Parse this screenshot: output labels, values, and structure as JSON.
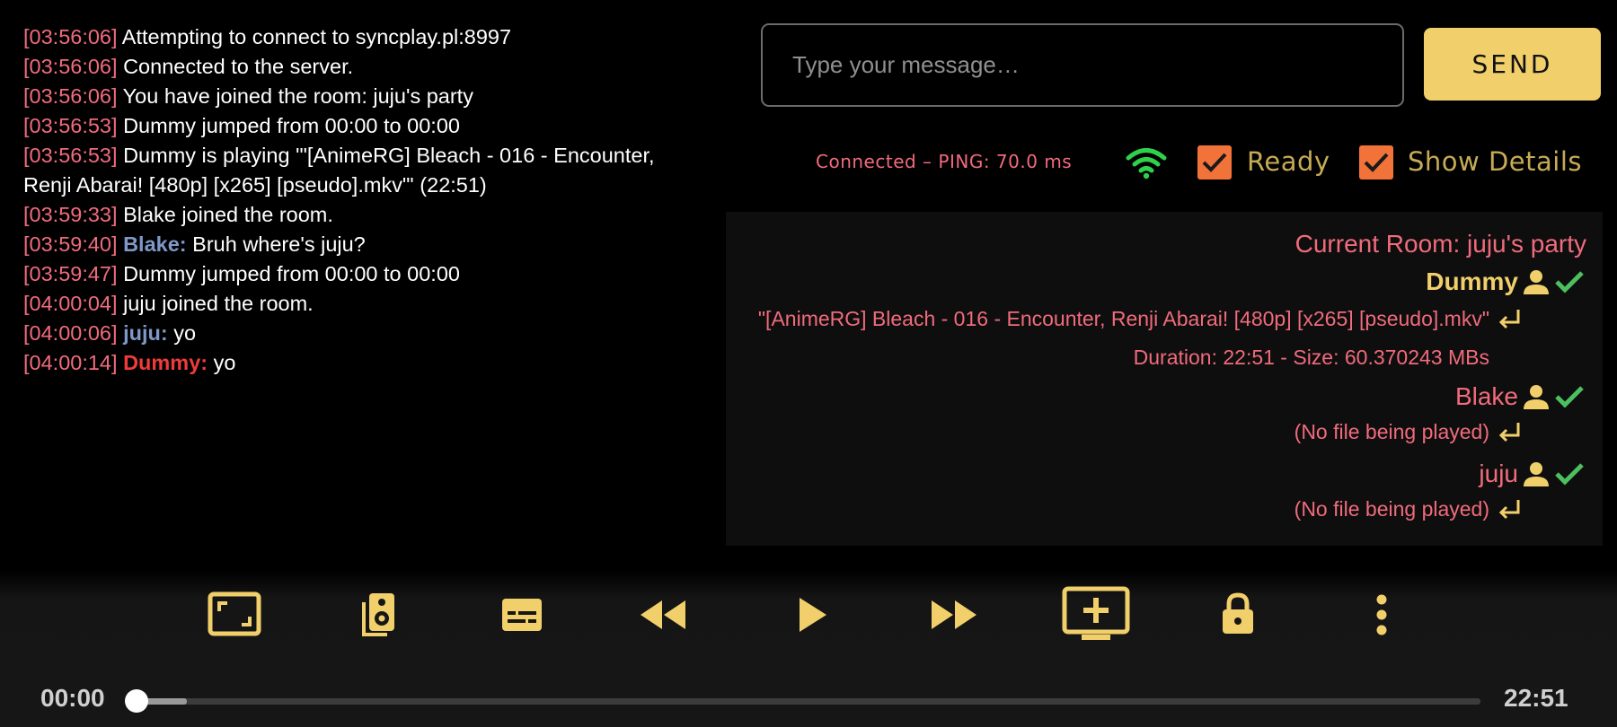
{
  "chat": {
    "messages": [
      {
        "time": "[03:56:06]",
        "user": "",
        "text": "Attempting to connect to syncplay.pl:8997"
      },
      {
        "time": "[03:56:06]",
        "user": "",
        "text": "Connected to the server."
      },
      {
        "time": "[03:56:06]",
        "user": "",
        "text": "You have joined the room: juju's party"
      },
      {
        "time": "[03:56:53]",
        "user": "",
        "text": "Dummy jumped from 00:00 to 00:00"
      },
      {
        "time": "[03:56:53]",
        "user": "",
        "text": "Dummy is playing '\"[AnimeRG] Bleach - 016 - Encounter, Renji Abarai! [480p] [x265] [pseudo].mkv\"' (22:51)"
      },
      {
        "time": "[03:59:33]",
        "user": "",
        "text": "Blake joined the room."
      },
      {
        "time": "[03:59:40]",
        "user": "Blake:",
        "text": "Bruh where's juju?"
      },
      {
        "time": "[03:59:47]",
        "user": "",
        "text": "Dummy jumped from 00:00 to 00:00"
      },
      {
        "time": "[04:00:04]",
        "user": "",
        "text": "juju joined the room."
      },
      {
        "time": "[04:00:06]",
        "user": "juju:",
        "text": "yo"
      },
      {
        "time": "[04:00:14]",
        "user": "Dummy:",
        "text": "yo"
      }
    ]
  },
  "input": {
    "placeholder": "Type your message…",
    "value": ""
  },
  "send_label": "SEND",
  "status": {
    "connection": "Connected – PING: 70.0 ms",
    "ready_label": "Ready",
    "ready_checked": true,
    "details_label": "Show Details",
    "details_checked": true
  },
  "room": {
    "title": "Current Room: juju's party",
    "users": [
      {
        "name": "Dummy",
        "file": "\"[AnimeRG] Bleach - 016 - Encounter, Renji Abarai! [480p] [x265] [pseudo].mkv\"",
        "details": "Duration: 22:51 - Size: 60.370243 MBs"
      },
      {
        "name": "Blake",
        "file": "(No file being played)",
        "details": ""
      },
      {
        "name": "juju",
        "file": "(No file being played)",
        "details": ""
      }
    ]
  },
  "player": {
    "current_time": "00:00",
    "total_time": "22:51",
    "progress": 0.0,
    "controls": [
      "aspect-ratio",
      "audio-track",
      "subtitles",
      "rewind",
      "play",
      "fast-forward",
      "add-media",
      "lock",
      "more"
    ]
  },
  "colors": {
    "accent": "#f1cf6a",
    "timestamp": "#f06b7c",
    "checkbox": "#f2733a",
    "wifi": "#2fd14a",
    "ready_check": "#4cbf5f"
  }
}
